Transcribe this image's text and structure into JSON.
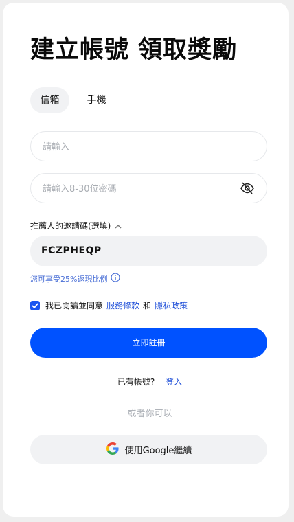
{
  "header": {
    "title": "建立帳號 領取獎勵"
  },
  "tabs": [
    {
      "label": "信箱"
    },
    {
      "label": "手機"
    }
  ],
  "form": {
    "email_placeholder": "請輸入",
    "password_placeholder": "請輸入8-30位密碼",
    "referral_label": "推薦人的邀請碼(選填)",
    "referral_value": "FCZPHEQP",
    "referral_hint": "您可享受25%返現比例",
    "agree_prefix": "我已閱讀並同意",
    "terms_link": "服務條款",
    "agree_and": "和",
    "privacy_link": "隱私政策",
    "submit_label": "立即註冊"
  },
  "login": {
    "prompt": "已有帳號?",
    "link": "登入"
  },
  "alt": {
    "or_text": "或者你可以",
    "google_label": "使用Google繼續"
  },
  "colors": {
    "accent": "#0052ff",
    "link": "#1f4fd8",
    "input_bg": "#f1f2f4"
  },
  "icons": {
    "password_toggle": "eye-off-icon",
    "referral_toggle": "chevron-up-icon",
    "hint": "info-icon",
    "google": "google-icon",
    "checkbox": "check-icon"
  }
}
